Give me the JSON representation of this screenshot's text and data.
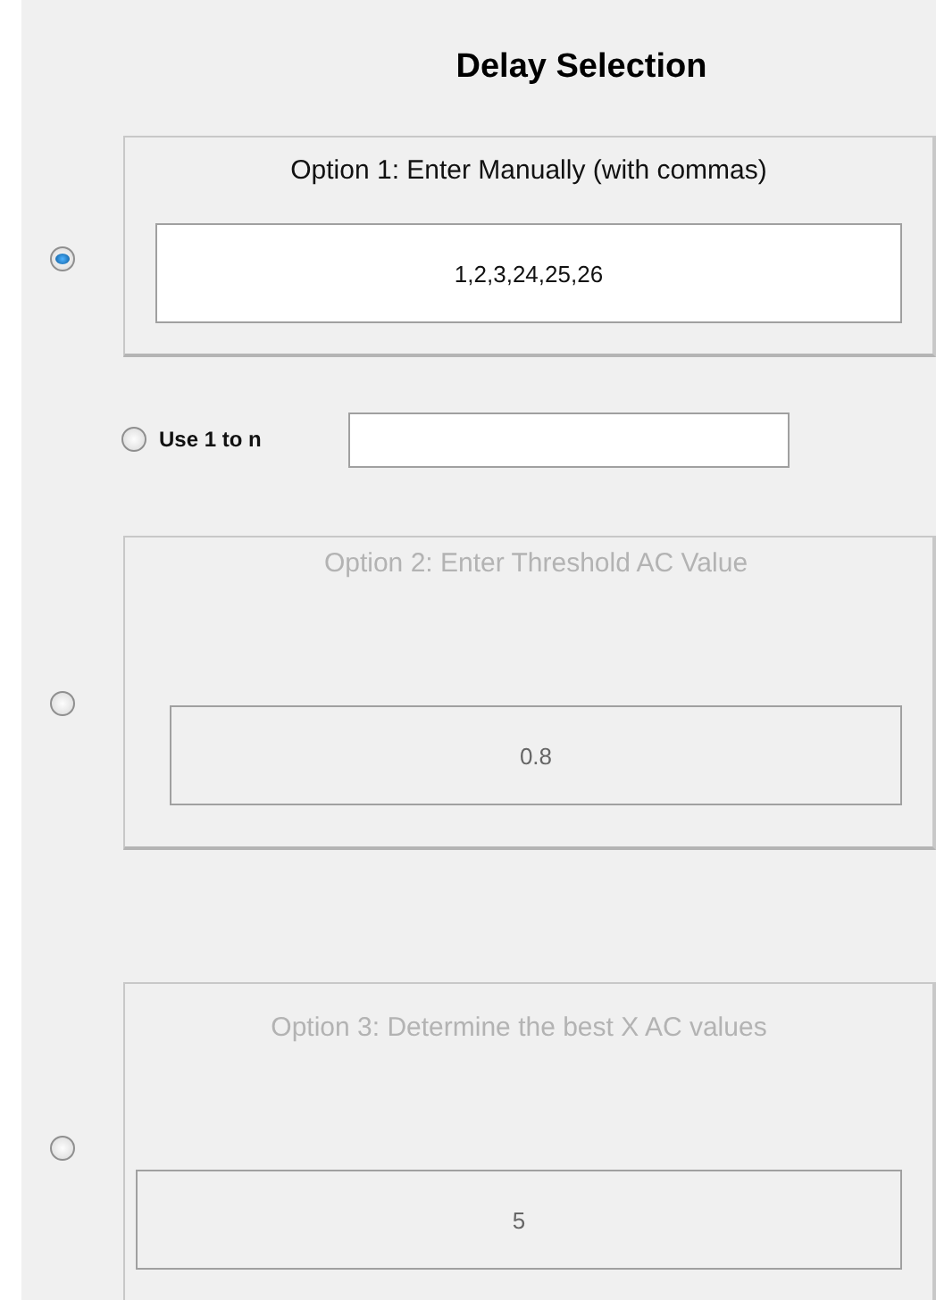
{
  "title": "Delay Selection",
  "options": [
    {
      "label": "Option 1: Enter Manually (with commas)",
      "value": "1,2,3,24,25,26",
      "selected": true,
      "disabled": false
    },
    {
      "label": "Option 2: Enter Threshold AC Value",
      "value": "0.8",
      "selected": false,
      "disabled": true
    },
    {
      "label": "Option 3: Determine the best X AC values",
      "value": "5",
      "selected": false,
      "disabled": true
    }
  ],
  "use_1_to_n": {
    "label": "Use 1 to n",
    "selected": false
  }
}
